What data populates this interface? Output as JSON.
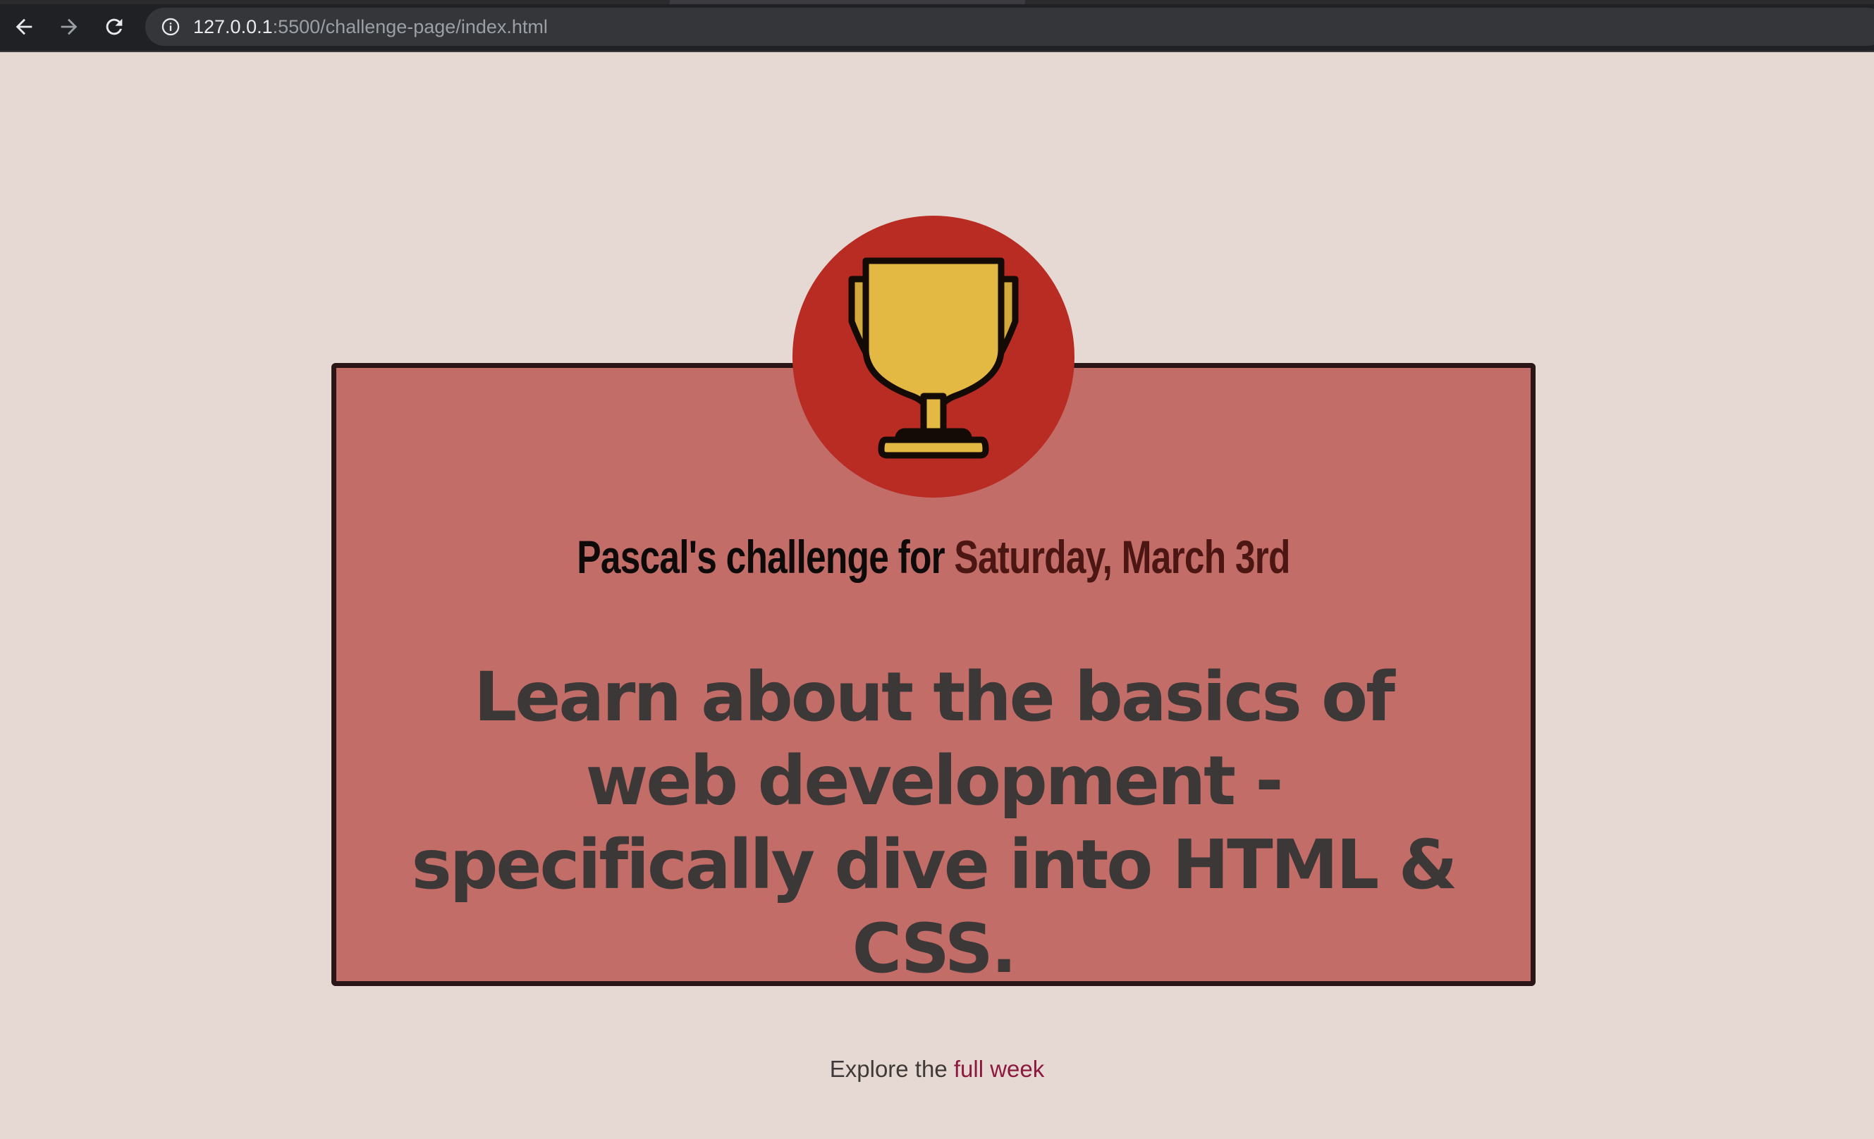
{
  "browser": {
    "url_host": "127.0.0.1",
    "url_rest": ":5500/challenge-page/index.html"
  },
  "icons": {
    "back": "arrow-back-icon",
    "forward": "arrow-forward-icon",
    "reload": "reload-icon",
    "info": "info-icon",
    "trophy": "trophy-icon"
  },
  "colors": {
    "page_background": "#e6d8d2",
    "card_background": "#c26d68",
    "card_border": "#2a1616",
    "trophy_circle": "#b92c23",
    "trophy_gold": "#e3b843",
    "date_text": "#4c1612",
    "link": "#8b1a3e"
  },
  "main": {
    "subtitle_prefix": "Pascal's challenge for ",
    "subtitle_date": "Saturday, March 3rd",
    "challenge": "Learn about the basics of web development - specifically dive into HTML & CSS."
  },
  "footer": {
    "prefix": "Explore the ",
    "link_label": "full week"
  }
}
